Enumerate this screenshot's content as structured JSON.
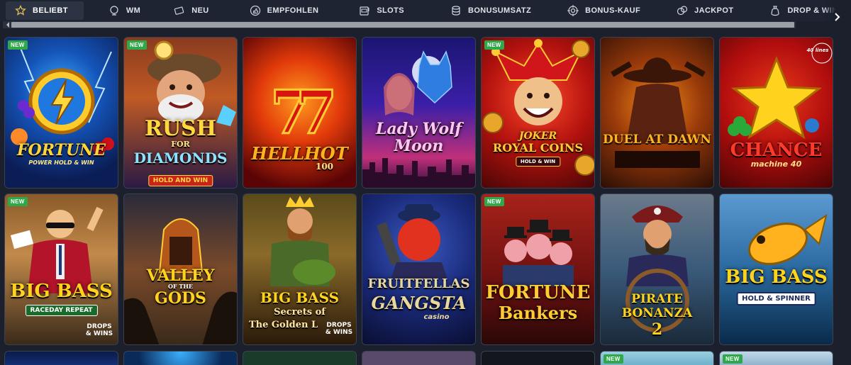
{
  "nav": {
    "tabs": [
      {
        "label": "BELIEBT",
        "icon": "star-icon",
        "active": true
      },
      {
        "label": "WM",
        "icon": "trophy-ball-icon",
        "active": false
      },
      {
        "label": "NEU",
        "icon": "tickets-icon",
        "active": false
      },
      {
        "label": "EMPFOHLEN",
        "icon": "thumbs-up-icon",
        "active": false
      },
      {
        "label": "SLOTS",
        "icon": "slot-machine-icon",
        "active": false
      },
      {
        "label": "BONUSUMSATZ",
        "icon": "coin-stack-icon",
        "active": false
      },
      {
        "label": "BONUS-KAUF",
        "icon": "target-icon",
        "active": false
      },
      {
        "label": "JACKPOT",
        "icon": "coins-icon",
        "active": false
      },
      {
        "label": "DROP & WINS",
        "icon": "money-bag-icon",
        "active": false
      }
    ],
    "next_icon": "chevron-right-icon"
  },
  "badge_new": "NEW",
  "games": [
    {
      "name_line1": "FORTUNE",
      "name_line2": "POWER HOLD & WIN",
      "new": true
    },
    {
      "name_line1": "RUSH",
      "name_mid": "FOR",
      "name_line2": "DIAMONDS",
      "tag": "HOLD AND WIN",
      "new": true
    },
    {
      "name_line1": "HELLHOT",
      "name_line2": "100",
      "new": false
    },
    {
      "name_line1": "Lady Wolf",
      "name_line2": "Moon",
      "new": false
    },
    {
      "name_line1": "JOKER",
      "name_line2": "ROYAL COINS",
      "tag": "HOLD & WIN",
      "new": true
    },
    {
      "name_line1": "DUEL AT DAWN",
      "new": false
    },
    {
      "name_line1": "CHANCE",
      "name_line2": "machine 40",
      "corner": "40 lines",
      "new": false
    },
    {
      "name_line1": "BIG BASS",
      "name_line2": "RACEDAY REPEAT",
      "tag": "DROPS & WINS",
      "new": true
    },
    {
      "name_line1": "VALLEY",
      "name_mid": "OF THE",
      "name_line2": "GODS",
      "new": false
    },
    {
      "name_line1": "BIG BASS",
      "name_mid": "Secrets of",
      "name_line2": "The Golden L",
      "tag": "DROPS & WINS",
      "new": false
    },
    {
      "name_line1": "FRUITFELLAS",
      "name_line2": "GANGSTA",
      "name_sub": "casino",
      "new": false
    },
    {
      "name_line1": "FORTUNE",
      "name_line2": "Bankers",
      "new": true
    },
    {
      "name_line1": "PIRATE",
      "name_line2": "BONANZA",
      "name_sub": "2",
      "new": false
    },
    {
      "name_line1": "BIG BASS",
      "name_line2": "HOLD & SPINNER",
      "new": false
    }
  ],
  "colors": {
    "nav_bg": "#1e2431",
    "page_bg": "#1b202c",
    "badge_green": "#2fa84a",
    "card_border": "#3a4252"
  }
}
